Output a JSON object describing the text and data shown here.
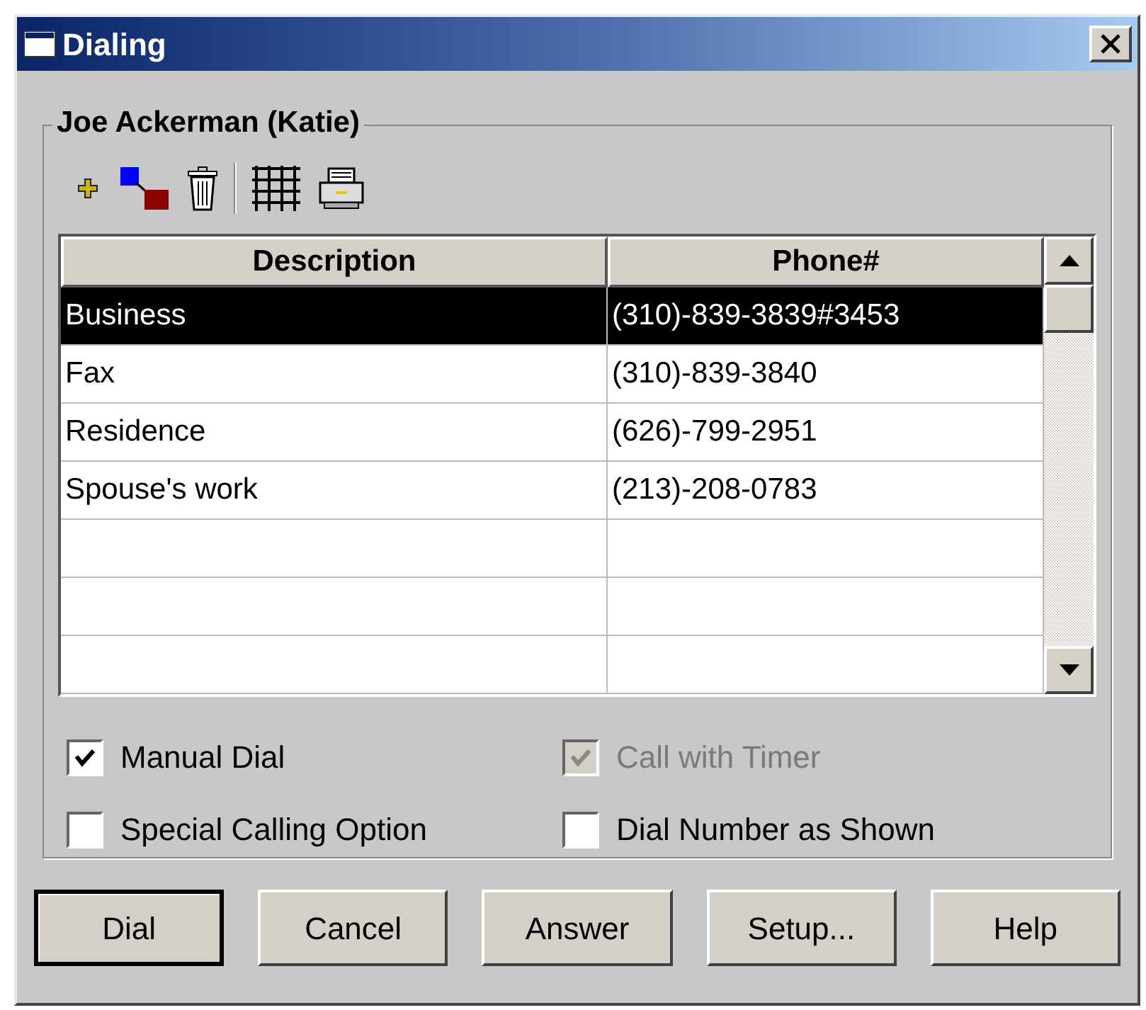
{
  "window": {
    "title": "Dialing"
  },
  "group": {
    "title": "Joe Ackerman (Katie)"
  },
  "table": {
    "columns": [
      "Description",
      "Phone#"
    ],
    "rows": [
      {
        "cells": [
          "Business",
          "(310)-839-3839#3453"
        ],
        "selected": true
      },
      {
        "cells": [
          "Fax",
          "(310)-839-3840"
        ],
        "selected": false
      },
      {
        "cells": [
          "Residence",
          "(626)-799-2951"
        ],
        "selected": false
      },
      {
        "cells": [
          "Spouse's work",
          "(213)-208-0783"
        ],
        "selected": false
      }
    ]
  },
  "options": [
    {
      "label": "Manual Dial",
      "checked": true,
      "disabled": false
    },
    {
      "label": "Call with Timer",
      "checked": true,
      "disabled": true
    },
    {
      "label": "Special Calling Option",
      "checked": false,
      "disabled": false
    },
    {
      "label": "Dial Number as Shown",
      "checked": false,
      "disabled": false
    }
  ],
  "buttons": [
    {
      "label": "Dial",
      "default": true
    },
    {
      "label": "Cancel",
      "default": false
    },
    {
      "label": "Answer",
      "default": false
    },
    {
      "label": "Setup...",
      "default": false
    },
    {
      "label": "Help",
      "default": false
    }
  ]
}
